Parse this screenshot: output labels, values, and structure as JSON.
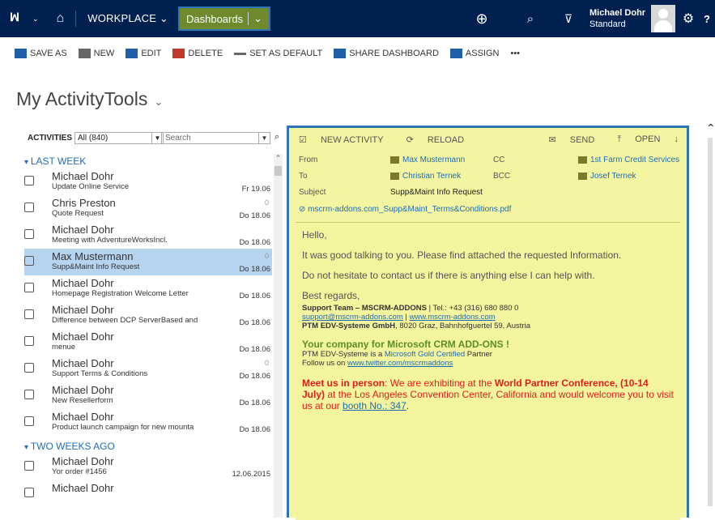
{
  "topbar": {
    "workplace": "WORKPLACE",
    "dashboards": "Dashboards",
    "user_name": "Michael Dohr",
    "user_role": "Standard"
  },
  "toolbar": {
    "save_as": "SAVE AS",
    "new": "NEW",
    "edit": "EDIT",
    "delete": "DELETE",
    "set_default": "SET AS DEFAULT",
    "share": "SHARE DASHBOARD",
    "assign": "ASSIGN",
    "more": "•••"
  },
  "page_title": "My ActivityTools",
  "activities": {
    "label": "ACTIVITIES",
    "filter": "All (840)",
    "search_placeholder": "Search"
  },
  "sections": [
    {
      "label": "LAST WEEK"
    },
    {
      "label": "TWO WEEKS AGO"
    }
  ],
  "items_last_week": [
    {
      "name": "Michael Dohr",
      "sub": "Update Online Service",
      "date": "Fr 19.06",
      "att": ""
    },
    {
      "name": "Chris Preston",
      "sub": "Quote Request",
      "date": "Do 18.06",
      "att": "0"
    },
    {
      "name": "Michael Dohr",
      "sub": "Meeting with AdventureWorksIncl.",
      "date": "Do 18.06",
      "att": ""
    },
    {
      "name": "Max Mustermann",
      "sub": "Supp&Maint Info Request",
      "date": "Do 18.06",
      "att": "0"
    },
    {
      "name": "Michael Dohr",
      "sub": "Homepage Registration Welcome Letter",
      "date": "Do 18.06",
      "att": ""
    },
    {
      "name": "Michael Dohr",
      "sub": "Difference between DCP ServerBased and",
      "date": "Do 18.06",
      "att": ""
    },
    {
      "name": "Michael Dohr",
      "sub": "menue",
      "date": "Do 18.06",
      "att": ""
    },
    {
      "name": "Michael Dohr",
      "sub": "Support Terms & Conditions",
      "date": "Do 18.06",
      "att": "0"
    },
    {
      "name": "Michael Dohr",
      "sub": "New Resellerform",
      "date": "Do 18.06",
      "att": ""
    },
    {
      "name": "Michael Dohr",
      "sub": "Product launch campaign for new mounta",
      "date": "Do 18.06",
      "att": ""
    }
  ],
  "items_two_weeks": [
    {
      "name": "Michael Dohr",
      "sub": "Yor order #1456",
      "date": "12.06.2015",
      "att": ""
    },
    {
      "name": "Michael Dohr",
      "sub": "",
      "date": "",
      "att": ""
    }
  ],
  "preview": {
    "new_activity": "NEW ACTIVITY",
    "reload": "RELOAD",
    "send": "SEND",
    "open": "OPEN",
    "from_label": "From",
    "from_value": "Max Mustermann",
    "cc_label": "CC",
    "cc_value": "1st Farm Credit Services",
    "to_label": "To",
    "to_value": "Christian Ternek",
    "bcc_label": "BCC",
    "bcc_value": "Josef Ternek",
    "subject_label": "Subject",
    "subject_value": "Supp&Maint Info Request",
    "attachment": "mscrm-addons.com_Supp&Maint_Terms&Conditions.pdf",
    "body_hello": "Hello,",
    "body_p1": "It was good talking to you. Please find attached the requested Information.",
    "body_p2": "Do not hesitate to contact us if there is anything else I can help with.",
    "body_regards": "Best regards,",
    "sig_team": "Support Team – MSCRM-ADDONS",
    "sig_tel": " | Tel.: +43 (316) 680 880 0",
    "sig_email": "support@mscrm-addons.com",
    "sig_sep": " | ",
    "sig_web": "www.mscrm-addons.com",
    "sig_company": "PTM EDV-Systeme GmbH",
    "sig_address": ", 8020 Graz, Bahnhofguertel 59, Austria",
    "sig_headline": "Your company for Microsoft CRM ADD-ONS !",
    "sig_partner_pre": "PTM EDV-Systeme is a ",
    "sig_partner": "Microsoft Gold Certified",
    "sig_partner_post": " Partner",
    "sig_follow": "Follow us on ",
    "sig_twitter": "www.twitter.com/mscrmaddons",
    "meet_bold": "Meet us in person",
    "meet_text1": ": We are exhibiting at the ",
    "meet_conf": "World Partner Conference,",
    "meet_dates": "(10-14 July)",
    "meet_text2": " at the Los Angeles Convention Center, California and would welcome you to visit us at our ",
    "meet_booth": "booth No.: 347",
    "meet_end": "."
  }
}
